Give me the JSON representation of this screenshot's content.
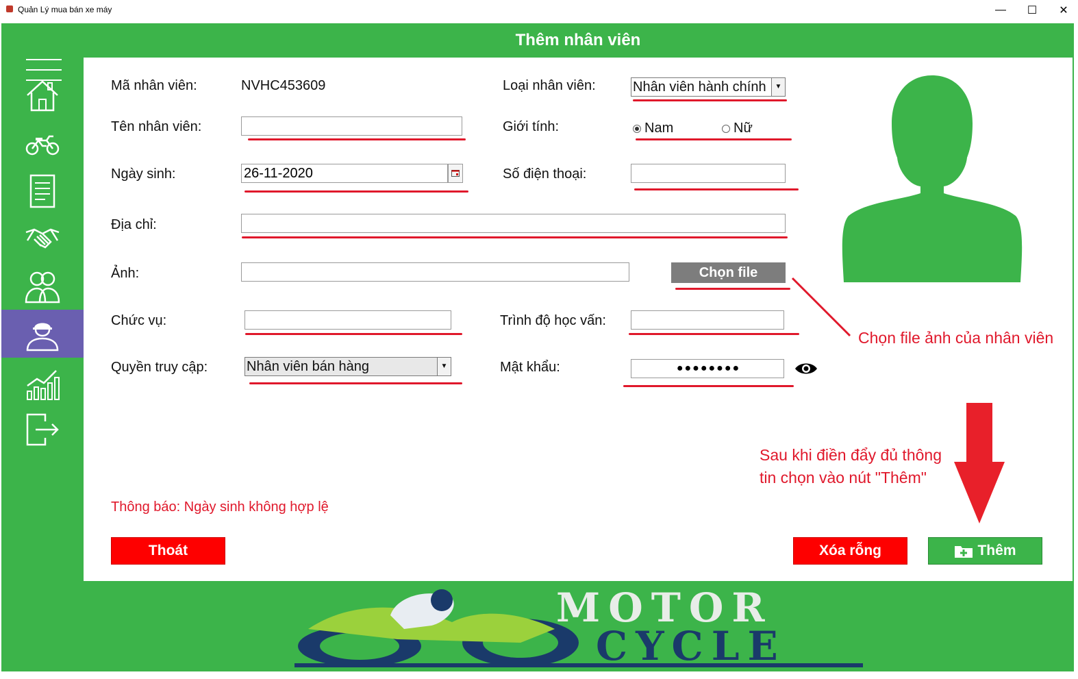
{
  "window": {
    "title": "Quản Lý mua bán xe máy",
    "minimize": "—",
    "maximize": "☐",
    "close": "✕"
  },
  "sidebar": {
    "items": [
      {
        "name": "home-icon"
      },
      {
        "name": "motorcycle-icon"
      },
      {
        "name": "document-icon"
      },
      {
        "name": "handshake-icon"
      },
      {
        "name": "customers-icon"
      },
      {
        "name": "employee-icon",
        "active": true
      },
      {
        "name": "statistics-icon"
      },
      {
        "name": "logout-icon"
      }
    ]
  },
  "header": {
    "title": "Thêm nhân viên"
  },
  "form": {
    "employee_id_label": "Mã nhân viên:",
    "employee_id_value": "NVHC453609",
    "employee_type_label": "Loại nhân viên:",
    "employee_type_value": "Nhân viên hành chính",
    "name_label": "Tên nhân viên:",
    "name_value": "",
    "gender_label": "Giới tính:",
    "gender_male": "Nam",
    "gender_female": "Nữ",
    "gender_selected": "Nam",
    "dob_label": "Ngày sinh:",
    "dob_value": "26-11-2020",
    "phone_label": "Số điện thoại:",
    "phone_value": "",
    "address_label": "Địa chỉ:",
    "address_value": "",
    "photo_label": "Ảnh:",
    "photo_value": "",
    "choose_file_button": "Chọn file",
    "position_label": "Chức vụ:",
    "position_value": "",
    "education_label": "Trình độ học vấn:",
    "education_value": "",
    "access_label": "Quyền truy cập:",
    "access_value": "Nhân viên bán hàng",
    "password_label": "Mật khẩu:",
    "password_value": "●●●●●●●●"
  },
  "notice": "Thông báo: Ngày sinh không hợp lệ",
  "buttons": {
    "exit": "Thoát",
    "clear": "Xóa rỗng",
    "add": "Thêm"
  },
  "annotations": {
    "choose_file_hint": "Chọn file ảnh của nhân viên",
    "add_hint_line1": "Sau khi điền đẩy đủ thông",
    "add_hint_line2": "tin chọn vào nút \"Thêm\""
  },
  "logo": {
    "line1": "MOTOR",
    "line2": "CYCLE"
  },
  "colors": {
    "brand_green": "#3cb44a",
    "active_nav": "#6a5fb0",
    "alert_red": "#e0182b",
    "button_red": "#fe0000"
  }
}
